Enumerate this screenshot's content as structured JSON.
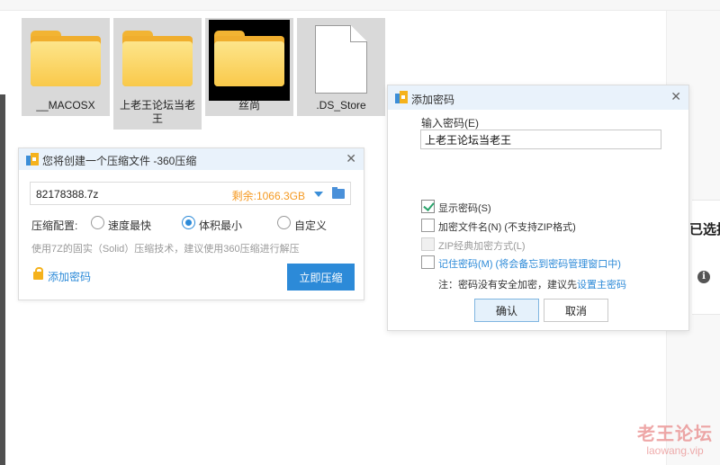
{
  "files": [
    {
      "name": "__MACOSX",
      "type": "folder"
    },
    {
      "name": "上老王论坛当老王",
      "type": "folder"
    },
    {
      "name": "丝尚",
      "type": "folder"
    },
    {
      "name": ".DS_Store",
      "type": "document"
    }
  ],
  "compress_dialog": {
    "title": "您将创建一个压缩文件 -360压缩",
    "filename": "82178388.7z",
    "remaining": "剩余:1066.3GB",
    "config_label": "压缩配置:",
    "options": [
      {
        "label": "速度最快",
        "selected": false
      },
      {
        "label": "体积最小",
        "selected": true
      },
      {
        "label": "自定义",
        "selected": false
      }
    ],
    "hint": "使用7Z的固实（Solid）压缩技术，建议使用360压缩进行解压",
    "add_password": "添加密码",
    "compress_button": "立即压缩"
  },
  "password_dialog": {
    "title": "添加密码",
    "input_label": "输入密码(E)",
    "password_value": "上老王论坛当老王",
    "options": [
      {
        "label": "显示密码(S)",
        "checked": true,
        "disabled": false,
        "link": false
      },
      {
        "label": "加密文件名(N) (不支持ZIP格式)",
        "checked": false,
        "disabled": false,
        "link": false
      },
      {
        "label": "ZIP经典加密方式(L)",
        "checked": false,
        "disabled": true,
        "link": false
      },
      {
        "label": "记住密码(M) (将会备忘到密码管理窗口中)",
        "checked": false,
        "disabled": false,
        "link": true
      }
    ],
    "note_prefix": "注：密码没有安全加密，建议先",
    "note_link": "设置主密码",
    "ok_button": "确认",
    "cancel_button": "取消"
  },
  "right_panel": {
    "title_fragment": "已选择"
  },
  "watermark": {
    "line1": "老王论坛",
    "line2": "laowang.vip"
  },
  "colors": {
    "accent": "#2c8ad8",
    "remaining": "#f59a23",
    "check": "#2aa36b"
  }
}
